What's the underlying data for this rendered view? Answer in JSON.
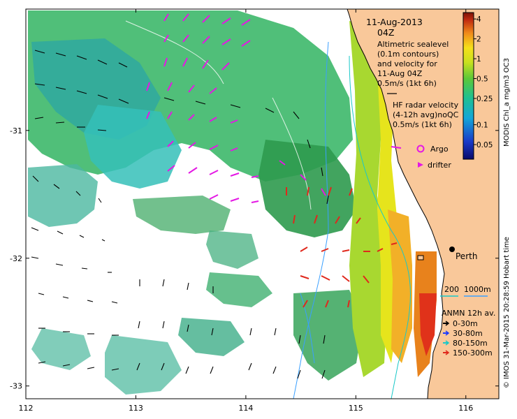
{
  "header": {
    "date": "11-Aug-2013",
    "time": "04Z"
  },
  "altimetry_note": {
    "lines": [
      "Altimetric sealevel",
      "(0.1m contours)",
      "and velocity for",
      "11-Aug 04Z",
      "0.5m/s (1kt 6h)"
    ]
  },
  "hf_radar_note": {
    "lines": [
      "HF radar velocity",
      "(4-12h avg)noQC",
      "0.5m/s (1kt 6h)"
    ]
  },
  "markers_legend": {
    "argo": "Argo",
    "drifter": "drifter"
  },
  "city": {
    "name": "Perth",
    "lon": 115.86,
    "lat": -31.95
  },
  "depth_contours": {
    "labels": [
      "200",
      "1000m"
    ]
  },
  "anmn_legend": {
    "title": "ANMN 12h av.",
    "items": [
      {
        "label": "0-30m",
        "color": "#000000"
      },
      {
        "label": "30-80m",
        "color": "#1b39ff"
      },
      {
        "label": "80-150m",
        "color": "#19c8c8"
      },
      {
        "label": "150-300m",
        "color": "#e0281c"
      }
    ]
  },
  "colorbar": {
    "title": "MODIS Chl_a mg/m3 OC3",
    "tick_labels": [
      "4",
      "2",
      "1",
      "0.5",
      "0.25",
      "0.1",
      "0.05"
    ],
    "tick_values": [
      4,
      2,
      1,
      0.5,
      0.25,
      0.1,
      0.05
    ],
    "range": [
      0.03,
      5
    ],
    "scale": "log"
  },
  "axes": {
    "x_ticks": [
      112,
      113,
      114,
      115,
      116
    ],
    "y_ticks": [
      -31,
      -32,
      -33
    ],
    "xlim": [
      112,
      116.3
    ],
    "ylim": [
      -33.1,
      -30.05
    ]
  },
  "credit": "© IMOS 31-Mar-2015 20:28:59 Hobart time",
  "colors": {
    "land": "#f9c89a",
    "coast": "#000000",
    "altimetry_vectors": "#000000",
    "hf_radar_vectors": "#e418e4",
    "red_vectors": "#e0281c",
    "argo": "#e418e4",
    "contour_200": "#19c8c8",
    "contour_1000": "#3aa0ff"
  }
}
